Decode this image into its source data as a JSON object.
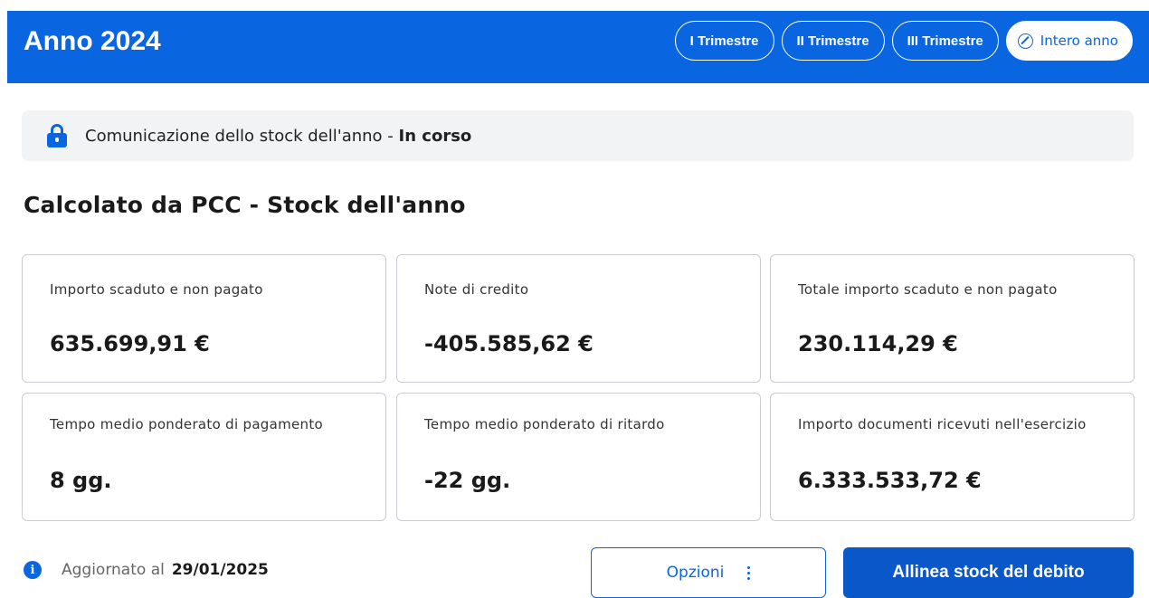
{
  "header": {
    "title": "Anno 2024",
    "tabs": [
      {
        "label": "I Trimestre",
        "active": false
      },
      {
        "label": "II Trimestre",
        "active": false
      },
      {
        "label": "III Trimestre",
        "active": false
      },
      {
        "label": "Intero anno",
        "active": true,
        "icon": "circle-slash-icon"
      }
    ]
  },
  "status": {
    "icon": "lock-icon",
    "text": "Comunicazione dello stock dell'anno - ",
    "state": "In corso"
  },
  "section": {
    "title": "Calcolato da PCC - Stock dell'anno"
  },
  "cards": [
    {
      "label": "Importo scaduto e non pagato",
      "value": "635.699,91 €"
    },
    {
      "label": "Note di credito",
      "value": "-405.585,62 €"
    },
    {
      "label": "Totale importo scaduto e non pagato",
      "value": "230.114,29 €"
    },
    {
      "label": "Tempo medio ponderato di pagamento",
      "value": "8 gg."
    },
    {
      "label": "Tempo medio ponderato di ritardo",
      "value": "-22 gg."
    },
    {
      "label": "Importo documenti ricevuti nell'esercizio",
      "value": "6.333.533,72 €"
    }
  ],
  "footer": {
    "info_icon": "info-icon",
    "updated_label": "Aggiornato al",
    "updated_date": "29/01/2025",
    "options_label": "Opzioni",
    "primary_label": "Allinea stock del debito"
  },
  "colors": {
    "brand": "#0a66e0",
    "primary_button": "#0a57c9",
    "status_bg": "#f2f3f5"
  }
}
